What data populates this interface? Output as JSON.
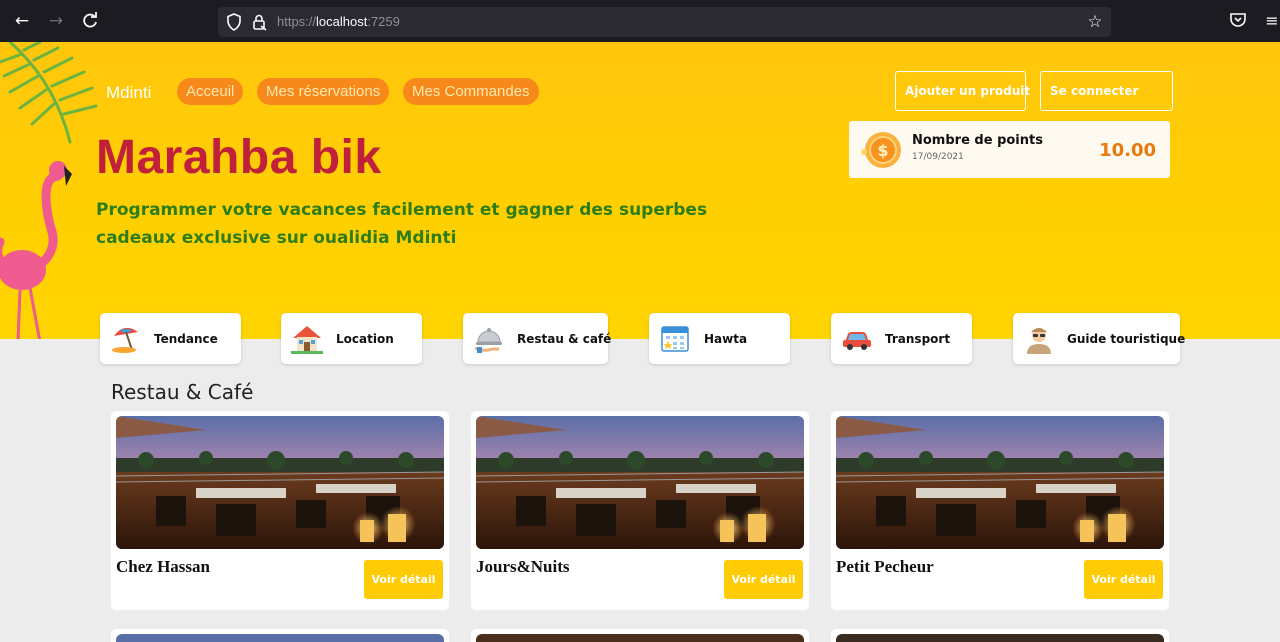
{
  "browser": {
    "url_scheme": "https://",
    "url_host": "localhost",
    "url_port": ":7259",
    "icons": [
      "back-icon",
      "forward-icon",
      "reload-icon",
      "shield-icon",
      "lock-icon",
      "star-icon",
      "pocket-icon",
      "menu-icon"
    ]
  },
  "header": {
    "brand": "Mdinti",
    "nav": [
      "Acceuil",
      "Mes réservations",
      "Mes Commandes"
    ],
    "add_product_label": "Ajouter un produit",
    "login_label": "Se connecter"
  },
  "hero": {
    "title": "Marahba bik",
    "subtitle": "Programmer votre vacances facilement et gagner des superbes cadeaux exclusive sur oualidia Mdinti"
  },
  "points": {
    "label": "Nombre de points",
    "date": "17/09/2021",
    "value": "10.00"
  },
  "categories": [
    {
      "label": "Tendance",
      "icon": "beach-umbrella-icon"
    },
    {
      "label": "Location",
      "icon": "house-icon"
    },
    {
      "label": "Restau & café",
      "icon": "cloche-icon"
    },
    {
      "label": "Hawta",
      "icon": "calendar-icon"
    },
    {
      "label": "Transport",
      "icon": "car-icon"
    },
    {
      "label": "Guide touristique",
      "icon": "guide-icon"
    }
  ],
  "section": {
    "title": "Restau & Café"
  },
  "restaurants": [
    {
      "name": "Chez Hassan",
      "button": "Voir détail"
    },
    {
      "name": "Jours&Nuits",
      "button": "Voir détail"
    },
    {
      "name": "Petit Pecheur",
      "button": "Voir détail"
    }
  ],
  "colors": {
    "hero_yellow": "#ffd000",
    "pill_orange": "#f7891a",
    "title_red": "#c0203a",
    "subtitle_green": "#2e7d18",
    "button_yellow": "#ffcb05",
    "points_orange": "#e8790f"
  }
}
